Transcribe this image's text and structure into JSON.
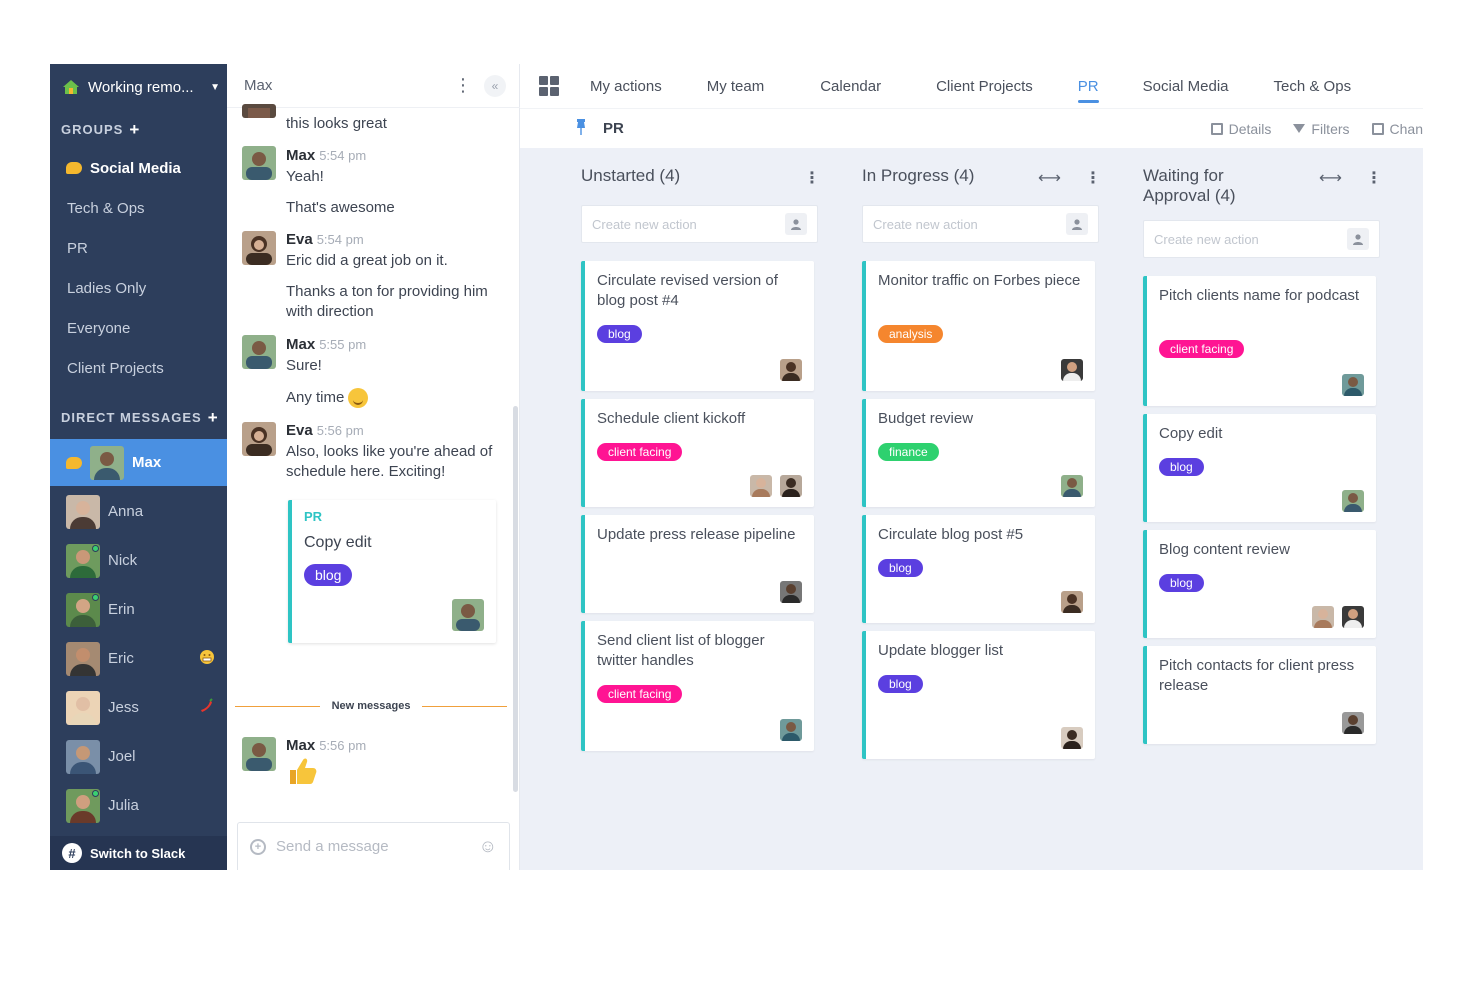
{
  "colors": {
    "sidebar_bg": "#2d3e5c",
    "accent_blue": "#4a90e2",
    "card_border_teal": "#2ec4c4",
    "tag_blog": "#5b3fe0",
    "tag_client_facing": "#ff1493",
    "tag_analysis": "#f5862e",
    "tag_finance": "#2ed16f"
  },
  "sidebar": {
    "workspace": "Working remo...",
    "groups_title": "GROUPS",
    "groups": [
      {
        "label": "Social Media",
        "active": true
      },
      {
        "label": "Tech & Ops"
      },
      {
        "label": "PR"
      },
      {
        "label": "Ladies Only"
      },
      {
        "label": "Everyone"
      },
      {
        "label": "Client Projects"
      }
    ],
    "dm_title": "DIRECT MESSAGES",
    "dms": [
      {
        "label": "Max",
        "active": true,
        "skin": "#7a5a44",
        "shirt": "#3a5a6e",
        "bg": "#8fb08a"
      },
      {
        "label": "Anna",
        "skin": "#d7b39b",
        "shirt": "#4b3b35",
        "bg": "#c9b8a8"
      },
      {
        "label": "Nick",
        "skin": "#c99878",
        "shirt": "#2d6b3a",
        "bg": "#6e9b5e",
        "online": true
      },
      {
        "label": "Erin",
        "skin": "#d2a585",
        "shirt": "#3c5f3a",
        "bg": "#5c8a4c",
        "online": true
      },
      {
        "label": "Eric",
        "skin": "#c28e6d",
        "shirt": "#343434",
        "bg": "#a58a72",
        "status_icon": "grimace-emoji-icon"
      },
      {
        "label": "Jess",
        "skin": "#e1bfa5",
        "shirt": "#e8d6b8",
        "bg": "#ecd4b6",
        "status_icon": "chili-pepper-icon"
      },
      {
        "label": "Joel",
        "skin": "#c59876",
        "shirt": "#3b5576",
        "bg": "#7a8fa8"
      },
      {
        "label": "Julia",
        "skin": "#cf9f7f",
        "shirt": "#6a3a2a",
        "bg": "#6f9a5d",
        "online": true
      }
    ],
    "switch_label": "Switch to Slack"
  },
  "chat": {
    "header": "Max",
    "messages": [
      {
        "author": "",
        "text": "this looks great"
      },
      {
        "author": "Max",
        "time": "5:54 pm",
        "text": "Yeah!"
      },
      {
        "author": "",
        "text": "That's awesome"
      },
      {
        "author": "Eva",
        "time": "5:54 pm",
        "text": "Eric did a great job on it."
      },
      {
        "author": "",
        "text": "Thanks a ton for providing him with direction"
      },
      {
        "author": "Max",
        "time": "5:55 pm",
        "text": "Sure!"
      },
      {
        "author": "",
        "text": "Any time"
      },
      {
        "author": "Eva",
        "time": "5:56 pm",
        "text": "Also, looks like you're ahead of schedule here. Exciting!"
      },
      {
        "author": "Max",
        "time": "5:56 pm",
        "text": ""
      }
    ],
    "shared_card": {
      "group": "PR",
      "title": "Copy edit",
      "tag": "blog"
    },
    "new_messages": "New messages",
    "composer_placeholder": "Send a message"
  },
  "board": {
    "tabs": [
      {
        "label": "My actions"
      },
      {
        "label": "My team"
      },
      {
        "label": "Calendar"
      },
      {
        "label": "Client Projects"
      },
      {
        "label": "PR",
        "active": true
      },
      {
        "label": "Social Media"
      },
      {
        "label": "Tech & Ops"
      }
    ],
    "title": "PR",
    "actions": {
      "details": "Details",
      "filters": "Filters",
      "chart": "Chan"
    },
    "create_placeholder": "Create new action",
    "columns": [
      {
        "title": "Unstarted (4)",
        "cards": [
          {
            "title": "Circulate revised version of blog post #4",
            "tag": "blog"
          },
          {
            "title": "Schedule client kickoff",
            "tag": "client facing"
          },
          {
            "title": "Update press release pipeline",
            "tag": ""
          },
          {
            "title": "Send client list of blogger twitter handles",
            "tag": "client facing"
          }
        ]
      },
      {
        "title": "In Progress (4)",
        "cards": [
          {
            "title": "Monitor traffic on Forbes piece",
            "tag": "analysis"
          },
          {
            "title": "Budget review",
            "tag": "finance"
          },
          {
            "title": "Circulate blog post #5",
            "tag": "blog"
          },
          {
            "title": "Update blogger list",
            "tag": "blog"
          }
        ]
      },
      {
        "title": "Waiting for Approval (4)",
        "cards": [
          {
            "title": "Pitch clients name for podcast",
            "tag": "client facing"
          },
          {
            "title": "Copy edit",
            "tag": "blog"
          },
          {
            "title": "Blog content review",
            "tag": "blog"
          },
          {
            "title": "Pitch contacts for client press release",
            "tag": ""
          }
        ]
      }
    ]
  }
}
